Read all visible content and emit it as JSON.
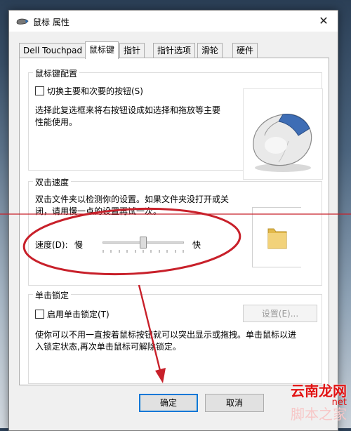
{
  "window": {
    "title": "鼠标 属性",
    "close_glyph": "✕"
  },
  "tabs": [
    "Dell Touchpad",
    "鼠标键",
    "指针",
    "指针选项",
    "滑轮",
    "硬件"
  ],
  "button_config": {
    "group_title": "鼠标键配置",
    "switch_label": "切换主要和次要的按钮(S)",
    "description_lines": [
      "选择此复选框来将右按钮设成如选择和拖放等主要",
      "性能使用。"
    ]
  },
  "double_click": {
    "group_title": "双击速度",
    "description_lines": [
      "双击文件夹以检测你的设置。如果文件夹没打开或关",
      "闭，请用慢一点的设置再试一次。"
    ],
    "speed_label": "速度(D):",
    "slow_label": "慢",
    "fast_label": "快",
    "speed_fraction": 0.5
  },
  "click_lock": {
    "group_title": "单击锁定",
    "enable_label": "启用单击锁定(T)",
    "settings_button": "设置(E)...",
    "description_lines": [
      "使你可以不用一直按着鼠标按钮就可以突出显示或拖拽。单击鼠标以进",
      "入锁定状态,再次单击鼠标可解除锁定。"
    ]
  },
  "footer": {
    "ok": "确定",
    "cancel": "取消"
  },
  "watermark": {
    "line1": "云南龙网",
    "line2": "net",
    "line3": "脚本之家"
  },
  "annotation_color": "#c8202a"
}
